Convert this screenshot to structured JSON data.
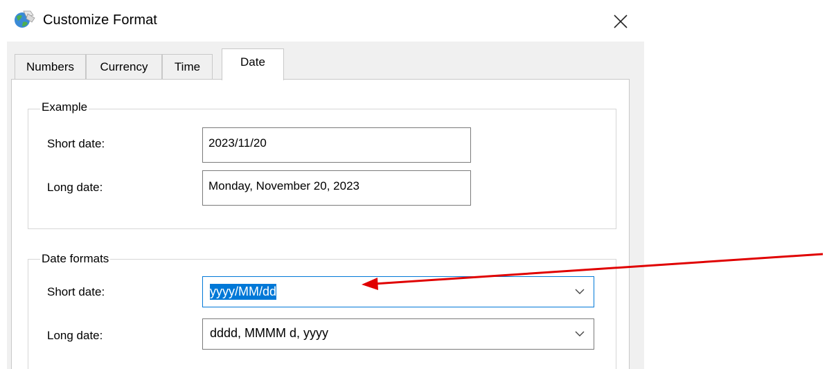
{
  "window": {
    "title": "Customize Format",
    "icon": "globe-icon",
    "close_icon": "close-icon"
  },
  "tabs": [
    {
      "label": "Numbers"
    },
    {
      "label": "Currency"
    },
    {
      "label": "Time"
    },
    {
      "label": "Date",
      "active": true
    }
  ],
  "example": {
    "legend": "Example",
    "short_label": "Short date:",
    "short_value": "2023/11/20",
    "long_label": "Long date:",
    "long_value": "Monday, November 20, 2023"
  },
  "formats": {
    "legend": "Date formats",
    "short_label": "Short date:",
    "short_value": "yyyy/MM/dd",
    "long_label": "Long date:",
    "long_value": "dddd, MMMM d, yyyy"
  },
  "colors": {
    "selection": "#0078d7",
    "annotation_arrow": "#e00000"
  }
}
